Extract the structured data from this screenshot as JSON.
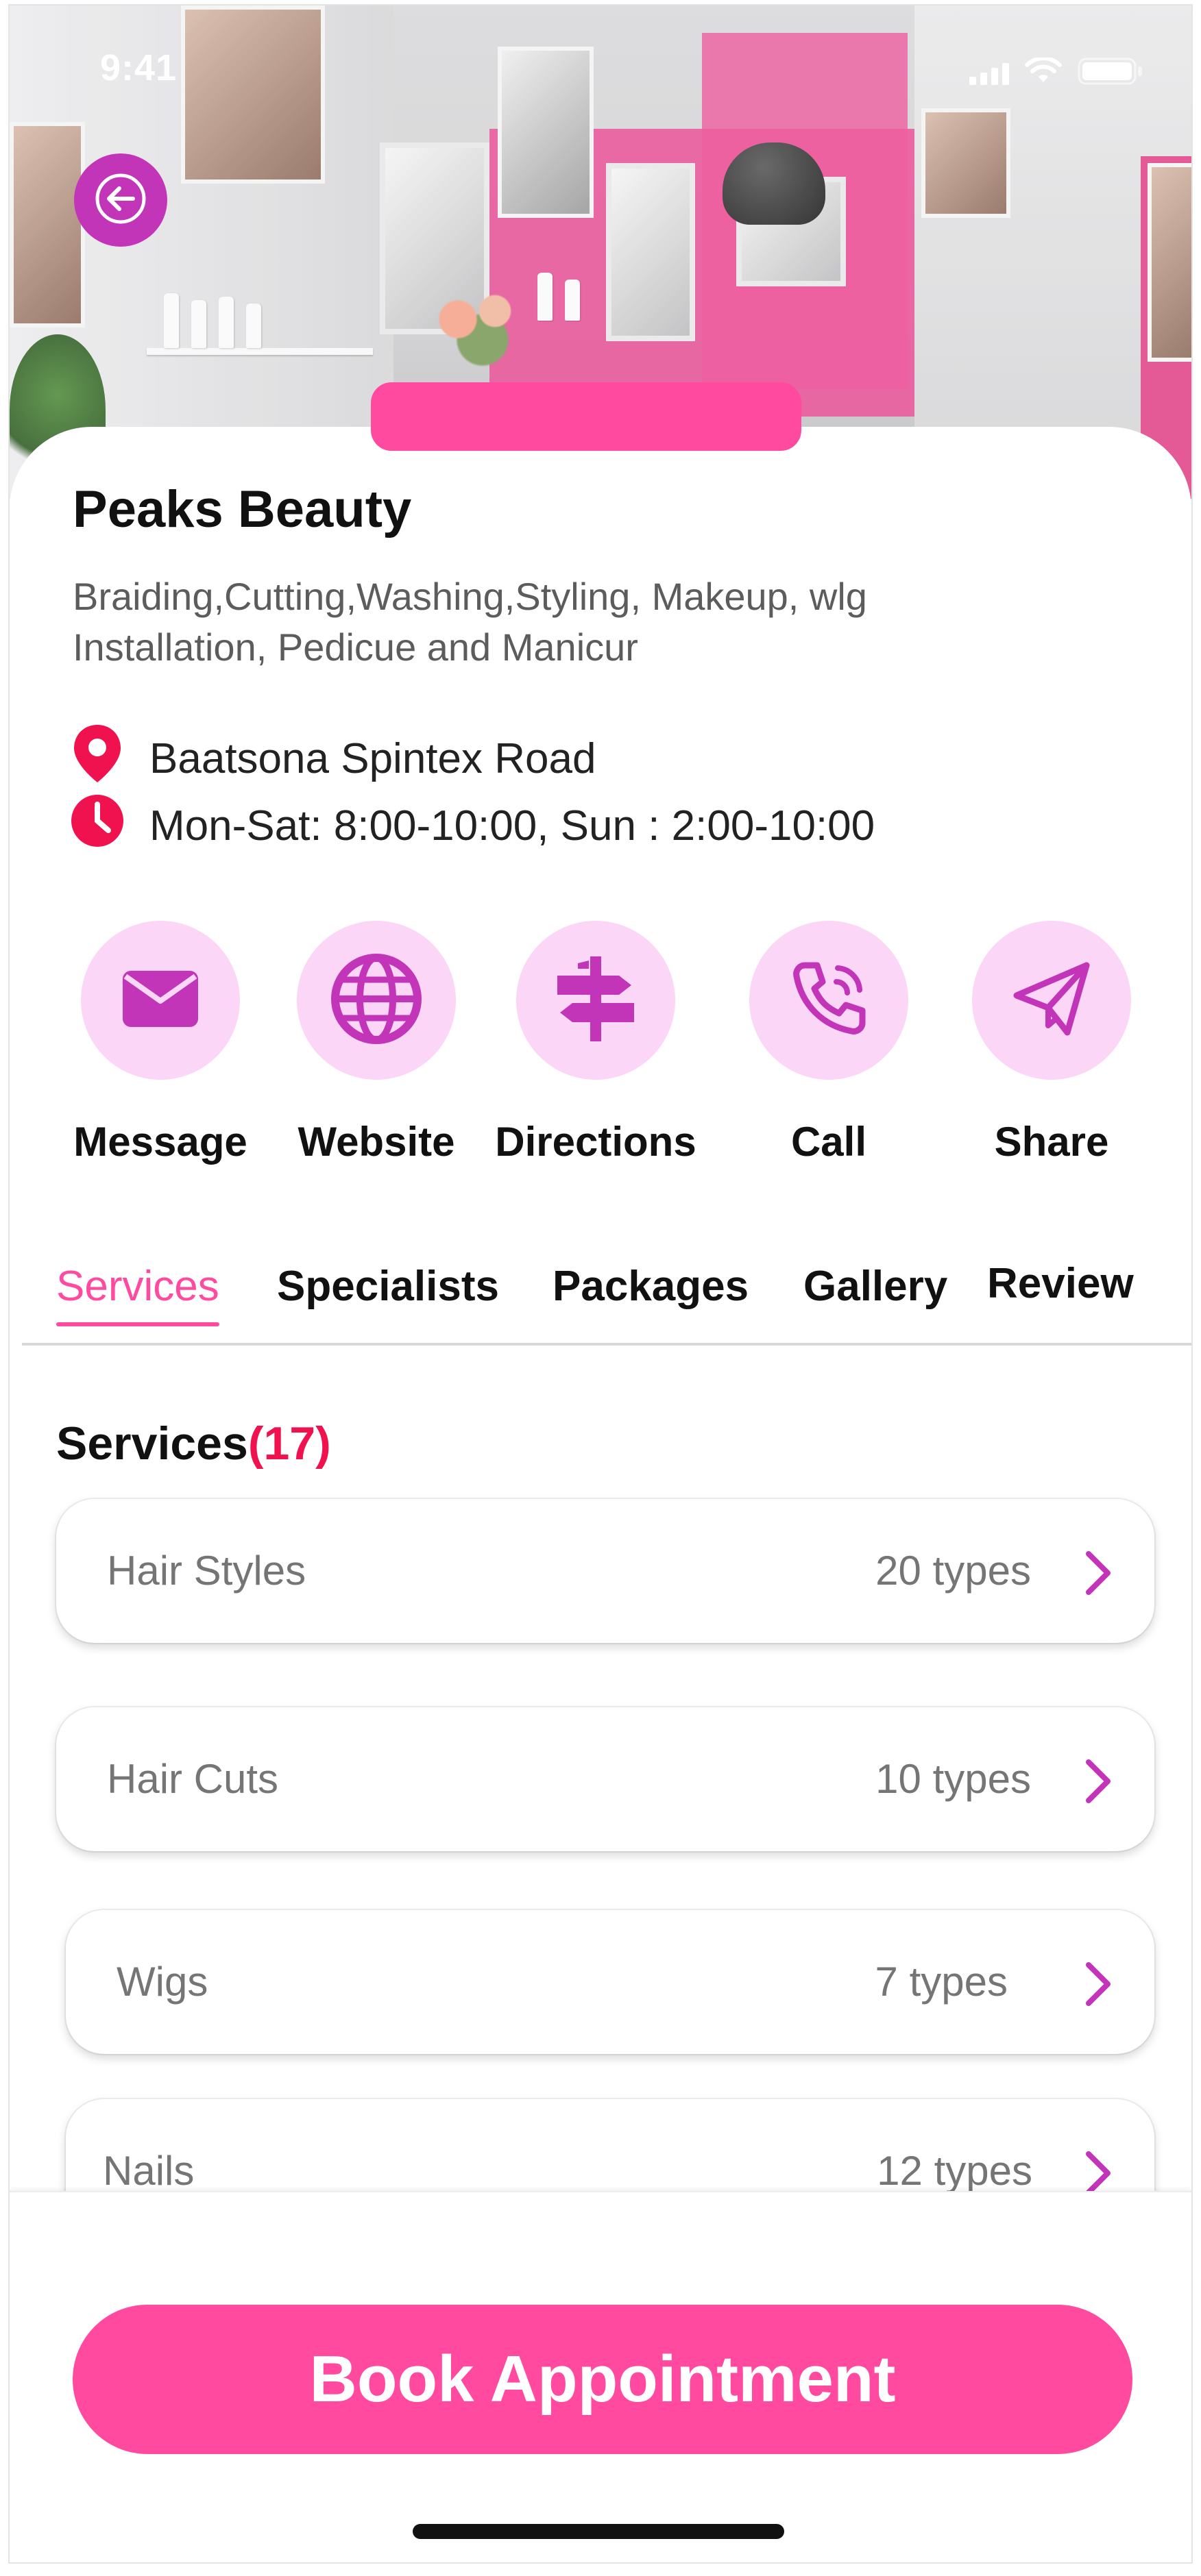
{
  "status_bar": {
    "time": "9:41",
    "icons": [
      "signal-icon",
      "wifi-icon",
      "battery-icon"
    ]
  },
  "header": {
    "back_icon": "arrow-left-icon"
  },
  "salon": {
    "name": "Peaks Beauty",
    "description": "Braiding,Cutting,Washing,Styling, Makeup, wlg\n Installation, Pedicue and Manicur",
    "address": "Baatsona Spintex Road",
    "hours": "Mon-Sat: 8:00-10:00, Sun : 2:00-10:00"
  },
  "actions": [
    {
      "label": "Message",
      "icon": "envelope-icon"
    },
    {
      "label": "Website",
      "icon": "globe-icon"
    },
    {
      "label": "Directions",
      "icon": "signpost-icon"
    },
    {
      "label": "Call",
      "icon": "phone-icon"
    },
    {
      "label": "Share",
      "icon": "paper-plane-icon"
    }
  ],
  "tabs": [
    {
      "label": "Services",
      "active": true
    },
    {
      "label": "Specialists",
      "active": false
    },
    {
      "label": "Packages",
      "active": false
    },
    {
      "label": "Gallery",
      "active": false
    },
    {
      "label": "Review",
      "active": false
    }
  ],
  "services": {
    "title": "Services",
    "count": "(17)",
    "items": [
      {
        "name": "Hair Styles",
        "types": "20 types"
      },
      {
        "name": "Hair Cuts",
        "types": "10 types"
      },
      {
        "name": "Wigs",
        "types": "7 types"
      },
      {
        "name": "Nails",
        "types": "12 types"
      }
    ]
  },
  "book_button": "Book Appointment",
  "colors": {
    "accent": "#ff4aa0",
    "icon_purple": "#c234b8",
    "icon_bg": "#fcd6f6",
    "count_red": "#f0124f"
  }
}
